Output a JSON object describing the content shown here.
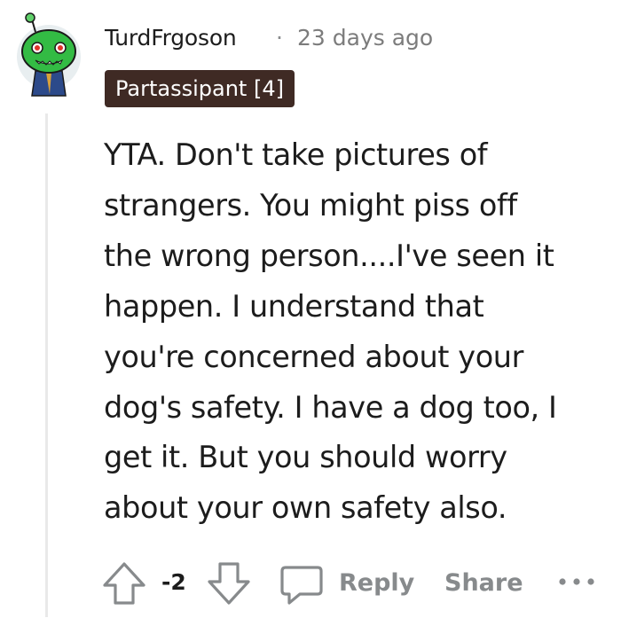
{
  "comment": {
    "username": "TurdFrgoson",
    "separator": "·",
    "timestamp": "23 days ago",
    "flair": "Partassipant [4]",
    "lines": [
      "YTA. Don't take pictures of",
      "strangers. You might piss off",
      "the wrong person....I've seen it",
      "happen. I understand that",
      "you're concerned about your",
      "dog's safety. I have a dog too, I",
      "get it. But you should worry",
      "about your own safety also."
    ],
    "vote_count": "-2",
    "reply_label": "Reply",
    "share_label": "Share"
  },
  "icons": {
    "avatar": "snoo-avatar-icon",
    "upvote": "upvote-arrow-icon",
    "downvote": "downvote-arrow-icon",
    "reply": "speech-bubble-icon",
    "more": "more-options-icon"
  },
  "colors": {
    "flair_bg": "#3f2a24",
    "muted": "#878a8c",
    "avatar_green": "#33bb44"
  }
}
